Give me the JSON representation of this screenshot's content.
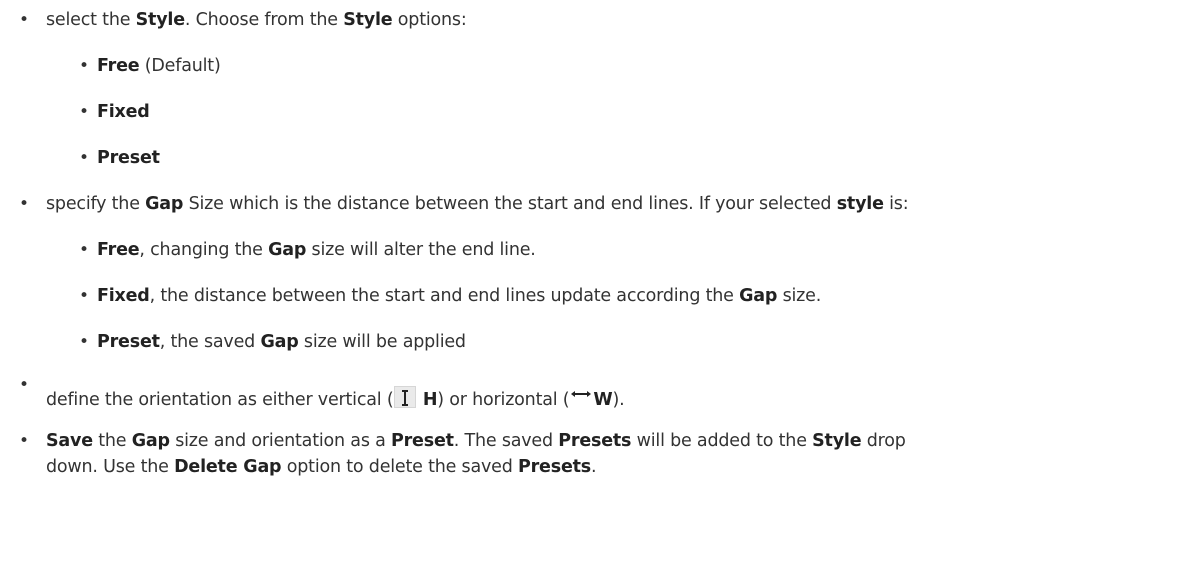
{
  "bullet": "•",
  "items": [
    {
      "id": "style",
      "segments": [
        "select the ",
        "Style",
        ". Choose from the ",
        "Style",
        " options:"
      ]
    },
    {
      "id": "free",
      "segments": [
        "Free",
        " (Default)"
      ]
    },
    {
      "id": "fixed",
      "segments": [
        "Fixed"
      ]
    },
    {
      "id": "preset",
      "segments": [
        "Preset"
      ]
    },
    {
      "id": "gap",
      "segments": [
        "specify the ",
        "Gap",
        " Size which is the distance between the start and end lines. If your selected ",
        "style",
        " is:"
      ]
    },
    {
      "id": "gap-free",
      "segments": [
        "Free",
        ", changing the ",
        "Gap",
        " size will alter the end line."
      ]
    },
    {
      "id": "gap-fixed",
      "segments": [
        "Fixed",
        ", the distance between the start and end lines update according the ",
        "Gap",
        " size."
      ]
    },
    {
      "id": "gap-preset",
      "segments": [
        "Preset",
        ", the saved ",
        "Gap",
        " size will be applied"
      ]
    },
    {
      "id": "orientation",
      "segments": [
        "define the orientation as either vertical (",
        "H",
        ") or horizontal (",
        "W",
        ")."
      ]
    },
    {
      "id": "save-1",
      "segments": [
        "Save",
        " the ",
        "Gap",
        " size and orientation as a ",
        "Preset",
        ". The saved ",
        "Presets",
        " will be added to the ",
        "Style",
        " drop"
      ]
    },
    {
      "id": "save-2",
      "segments": [
        "down. Use the ",
        "Delete Gap",
        " option to delete the saved ",
        "Presets",
        "."
      ]
    }
  ],
  "icons": {
    "vertical": "vertical-arrow-icon",
    "horizontal": "horizontal-arrow-icon"
  }
}
